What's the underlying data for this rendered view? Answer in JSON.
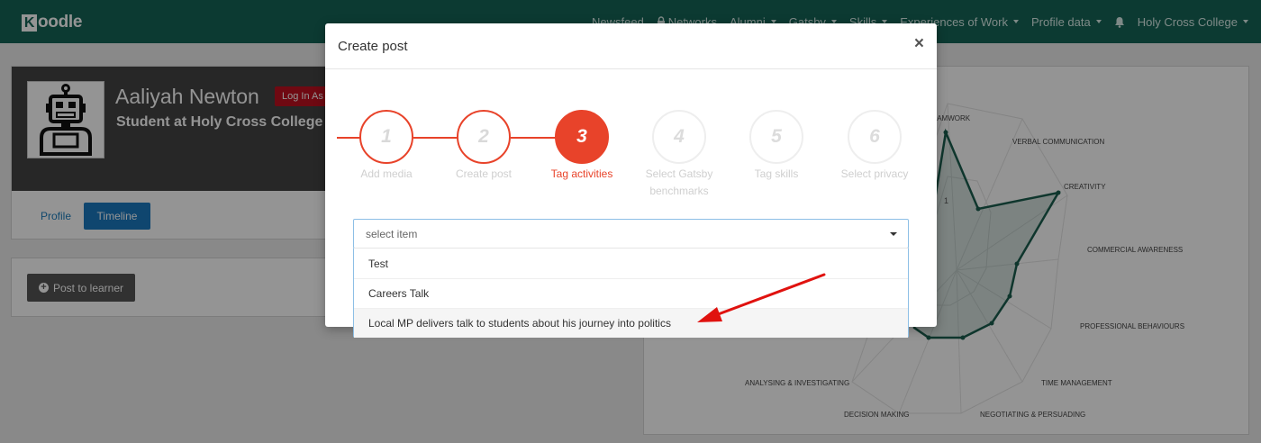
{
  "navbar": {
    "brand_k": "K",
    "brand_rest": "oodle",
    "items": [
      "Newsfeed",
      "Networks",
      "Alumni",
      "Gatsby",
      "Skills",
      "Experiences of Work",
      "Profile data",
      "Holy Cross College"
    ]
  },
  "profile": {
    "name": "Aaliyah Newton",
    "login_as": "Log In As",
    "subtitle": "Student at Holy Cross College",
    "tabs": [
      "Profile",
      "Timeline"
    ],
    "post_button": "Post to learner"
  },
  "radar": {
    "labels": [
      "TEAMWORK",
      "VERBAL COMMUNICATION",
      "CREATIVITY",
      "COMMERCIAL AWARENESS",
      "PROFESSIONAL BEHAVIOURS",
      "TIME MANAGEMENT",
      "NEGOTIATING & PERSUADING",
      "DECISION MAKING",
      "ANALYSING & INVESTIGATING"
    ],
    "tick_label": "1",
    "accent_color": "#1a5e4f"
  },
  "modal": {
    "title": "Create post",
    "close": "×",
    "steps": [
      {
        "num": "1",
        "label": "Add media",
        "state": "done"
      },
      {
        "num": "2",
        "label": "Create post",
        "state": "done"
      },
      {
        "num": "3",
        "label": "Tag activities",
        "state": "active"
      },
      {
        "num": "4",
        "label": "Select Gatsby benchmarks",
        "state": "todo"
      },
      {
        "num": "5",
        "label": "Tag skills",
        "state": "todo"
      },
      {
        "num": "6",
        "label": "Select privacy",
        "state": "todo"
      }
    ],
    "select_placeholder": "select item",
    "options": [
      "Test",
      "Careers Talk",
      "Local MP delivers talk to students about his journey into politics"
    ]
  },
  "colors": {
    "navbar": "#156556",
    "step_active": "#e8432a",
    "annotation_arrow": "#e0120f"
  }
}
